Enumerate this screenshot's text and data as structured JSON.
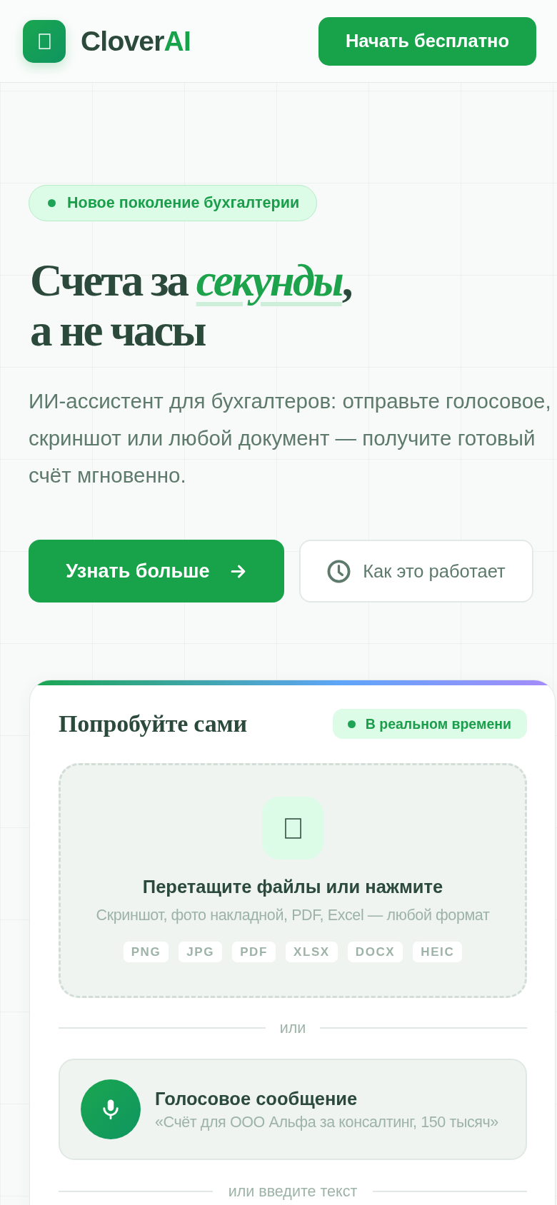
{
  "header": {
    "logo": {
      "name": "Clover",
      "accent": "AI"
    },
    "cta": "Начать бесплатно"
  },
  "hero": {
    "badge": "Новое поколение бухгалтерии",
    "title": [
      "Счета за *секунды*,",
      "а не часы"
    ],
    "lead": "ИИ-ассистент для бухгалтеров: отправьте голосовое, скриншот или любой документ — получите готовый счёт мгновенно.",
    "buttons": [
      {
        "kind": "primary",
        "label": "Узнать больше"
      },
      {
        "kind": "secondary",
        "label": "Как это работает"
      }
    ]
  },
  "demo": {
    "title": "Попробуйте сами",
    "badge": "В реальном времени",
    "dropzone": {
      "title": "Перетащите файлы или нажмите",
      "hint": "Скриншот, фото накладной, PDF, Excel — любой формат",
      "formats": [
        "PNG",
        "JPG",
        "PDF",
        "XLSX",
        "DOCX",
        "HEIC"
      ]
    },
    "divider": "или",
    "voice": {
      "title": "Голосовое сообщение",
      "example": "«Счёт для ООО Альфа за консалтинг, 150 тысяч»"
    },
    "text_divider": "или введите текст"
  }
}
